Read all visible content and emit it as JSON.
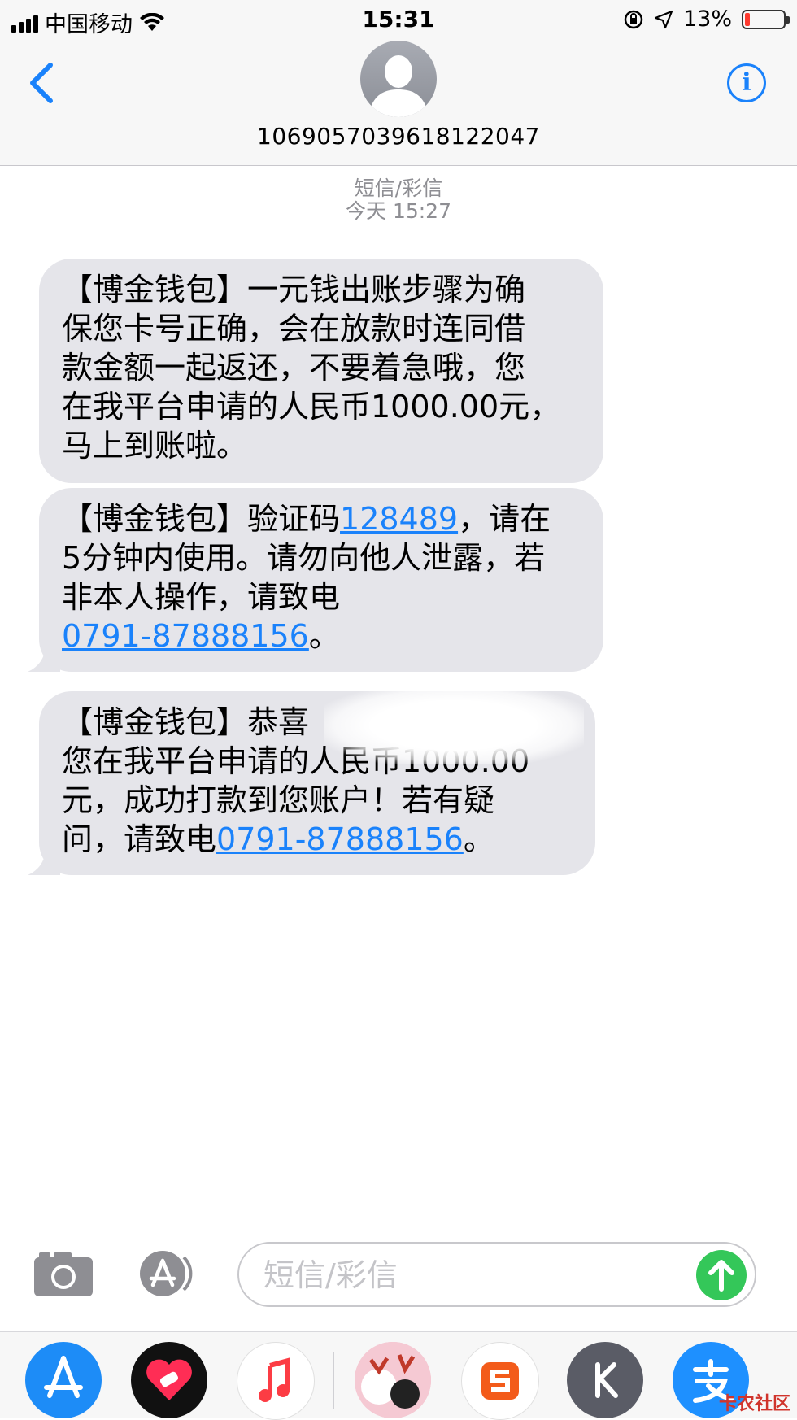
{
  "status_bar": {
    "carrier": "中国移动",
    "time": "15:31",
    "battery": "13%",
    "battery_level": 0.13
  },
  "header": {
    "contact": "1069057039618122047"
  },
  "thread": {
    "service": "短信/彩信",
    "timestamp": "今天 15:27"
  },
  "messages": [
    {
      "lines": [
        "【博金钱包】一元钱出账步骤为确",
        "保您卡号正确，会在放款时连同借",
        "款金额一起返还，不要着急哦，您",
        "在我平台申请的人民币1000.00元，",
        "马上到账啦。"
      ]
    },
    {
      "line1_pre": "【博金钱包】验证码",
      "code": "128489",
      "line1_post": "，请在",
      "line2": "5分钟内使用。请勿向他人泄露，若",
      "line3": "非本人操作，请致电",
      "phone": "0791-87888156",
      "line4_post": "。"
    },
    {
      "line1": "【博金钱包】恭喜",
      "line2": "您在我平台申请的人民币1000.00",
      "line3": "元，成功打款到您账户！若有疑",
      "line4_pre": "问，请致电",
      "phone": "0791-87888156",
      "line4_post": "。"
    }
  ],
  "composer": {
    "placeholder": "短信/彩信"
  },
  "dock": {
    "apps": [
      "app-store-icon",
      "heart-app-icon",
      "music-icon",
      "sticker-app-icon",
      "sogou-icon",
      "k-app-icon",
      "alipay-icon"
    ],
    "watermark": "卡农社区"
  },
  "colors": {
    "accent": "#1a82fb",
    "bubble": "#e5e5ea",
    "send": "#34c759",
    "battery_low": "#ff3b30"
  }
}
